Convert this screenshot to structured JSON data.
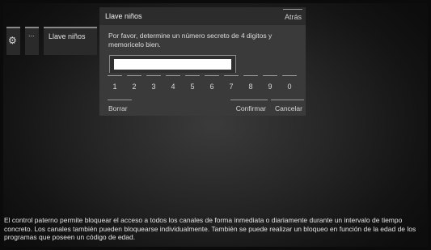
{
  "menu": {
    "settings_icon": "gear-icon",
    "more_label": "...",
    "item_label": "Llave niños"
  },
  "dialog": {
    "title": "Llave niños",
    "back_label": "Atrás",
    "instruction": "Por favor, determine un número secreto de 4 digitos y memoricelo bien.",
    "pin_value": "",
    "keypad": [
      "1",
      "2",
      "3",
      "4",
      "5",
      "6",
      "7",
      "8",
      "9",
      "0"
    ],
    "clear_label": "Borrar",
    "confirm_label": "Confirmar",
    "cancel_label": "Cancelar"
  },
  "help_text": "El control paterno permite bloquear el acceso a todos los canales de forma inmediata o diariamente durante un intervalo de tiempo concreto. Los canales también pueden bloquearse individualmente. También se puede realizar un bloqueo en función de la edad de los programas  que poseen un código de edad.",
  "colors": {
    "dialog_bg": "#3a3a3a",
    "header_bg": "#2c2c2c",
    "input_bg": "#ffffff"
  }
}
